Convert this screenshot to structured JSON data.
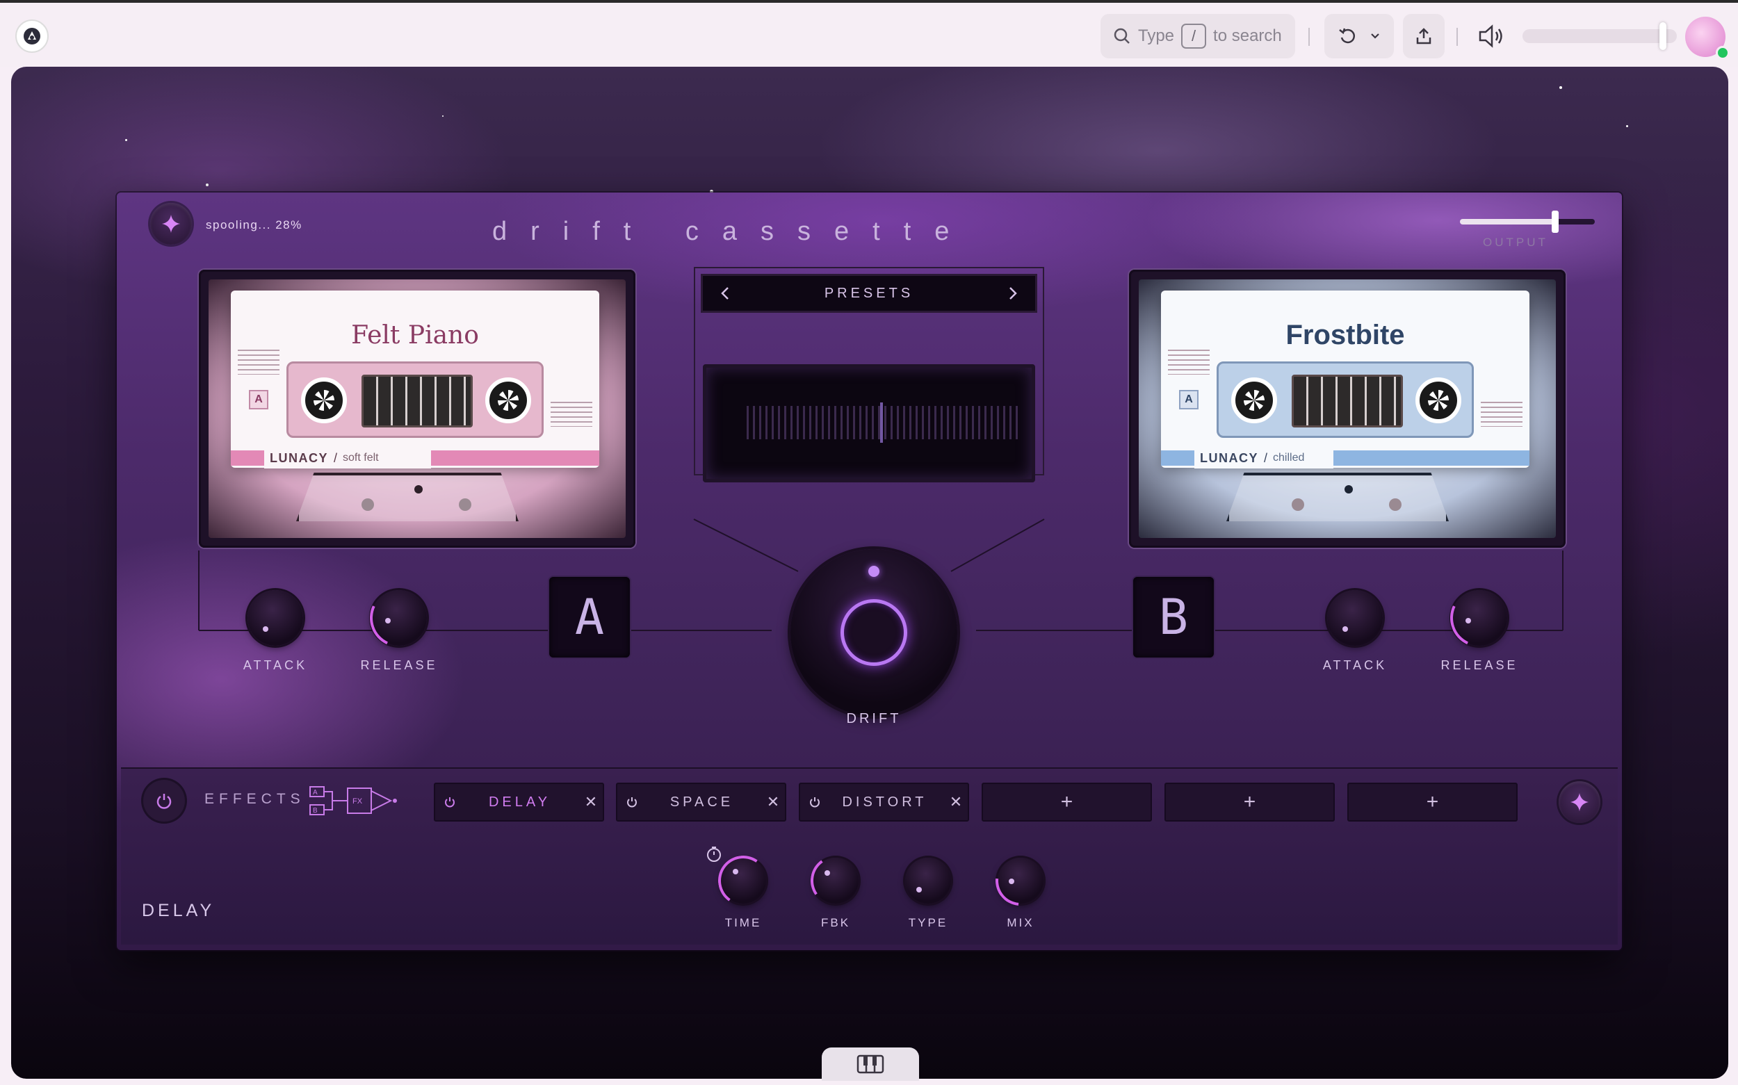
{
  "app": {
    "search": {
      "prefix": "Type",
      "key": "/",
      "suffix": "to search"
    },
    "volume_level": 0.91
  },
  "plugin": {
    "title": "drift cassette",
    "status": "spooling... 28%",
    "output_label": "OUTPUT",
    "output_level": 0.68,
    "presets_label": "PRESETS",
    "deck_a": {
      "title": "Felt Piano",
      "side": "A",
      "brand": "LUNACY",
      "subtitle": "soft felt",
      "digit": "A",
      "knobs": [
        {
          "label": "ATTACK"
        },
        {
          "label": "RELEASE"
        }
      ]
    },
    "deck_b": {
      "title": "Frostbite",
      "side": "A",
      "brand": "LUNACY",
      "subtitle": "chilled",
      "digit": "B",
      "knobs": [
        {
          "label": "ATTACK"
        },
        {
          "label": "RELEASE"
        }
      ]
    },
    "drift_label": "DRIFT",
    "effects": {
      "label": "EFFECTS",
      "chain_fx": "FX",
      "chain_a": "A",
      "chain_b": "B",
      "slots": [
        {
          "name": "DELAY",
          "active": true
        },
        {
          "name": "SPACE",
          "active": false
        },
        {
          "name": "DISTORT",
          "active": false
        }
      ],
      "add_symbol": "+",
      "close_symbol": "✕",
      "selected_name": "DELAY",
      "params": [
        {
          "label": "TIME"
        },
        {
          "label": "FBK"
        },
        {
          "label": "TYPE"
        },
        {
          "label": "MIX"
        }
      ]
    }
  },
  "icons": {
    "app_logo": "app-logo-icon",
    "search": "search-icon",
    "undo": "undo-icon",
    "chevron": "chevron-down-icon",
    "share": "share-icon",
    "volume": "speaker-icon",
    "sparkle": "sparkle-icon",
    "power": "power-icon",
    "keyboard": "piano-keyboard-icon"
  },
  "colors": {
    "accent": "#b978f2",
    "active_slot": "#d27df1",
    "online": "#22c55e"
  }
}
